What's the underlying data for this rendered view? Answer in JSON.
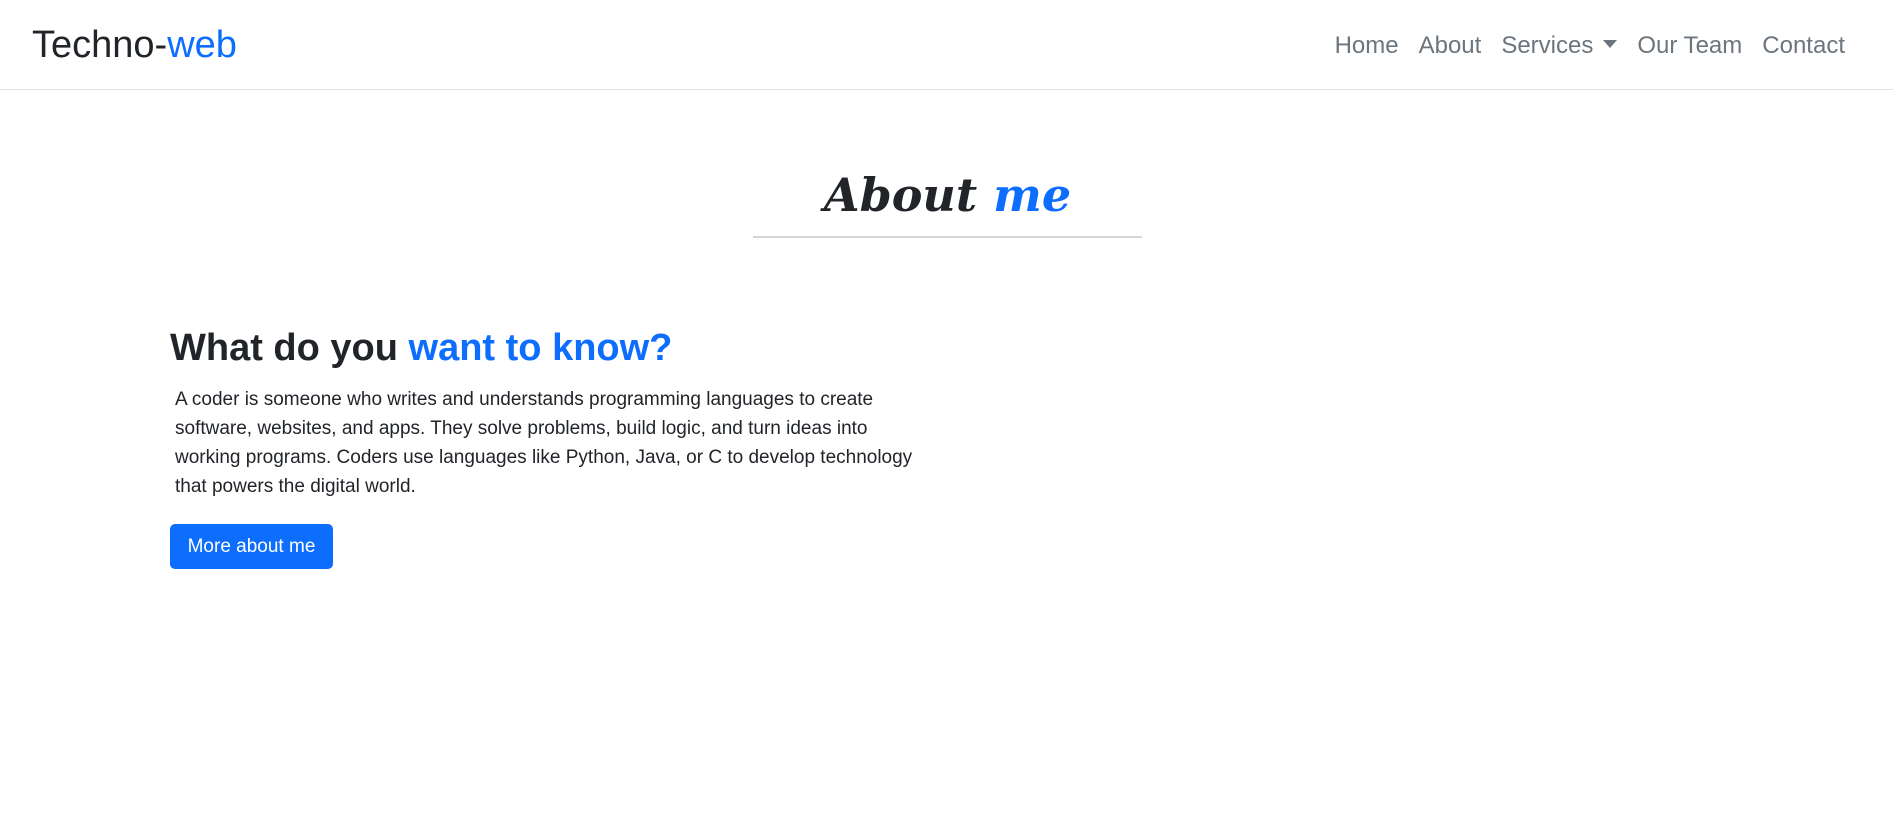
{
  "colors": {
    "accent": "#0d6efd",
    "text": "#212529",
    "nav_text": "#6c757d",
    "divider": "#dee2e6"
  },
  "navbar": {
    "brand": {
      "primary": "Techno-",
      "accent": "web"
    },
    "links": {
      "home": "Home",
      "about": "About",
      "services": "Services",
      "team": "Our Team",
      "contact": "Contact"
    },
    "services_icon": "caret-down-icon"
  },
  "about": {
    "title": {
      "primary": "About ",
      "accent": "me"
    },
    "heading": {
      "primary": "What do you ",
      "accent": "want to know?"
    },
    "paragraph": "A coder is someone who writes and understands programming languages to create software, websites, and apps. They solve problems, build logic, and turn ideas into working programs. Coders use languages like Python, Java, or C to develop technology that powers the digital world.",
    "button_label": "More about me"
  }
}
